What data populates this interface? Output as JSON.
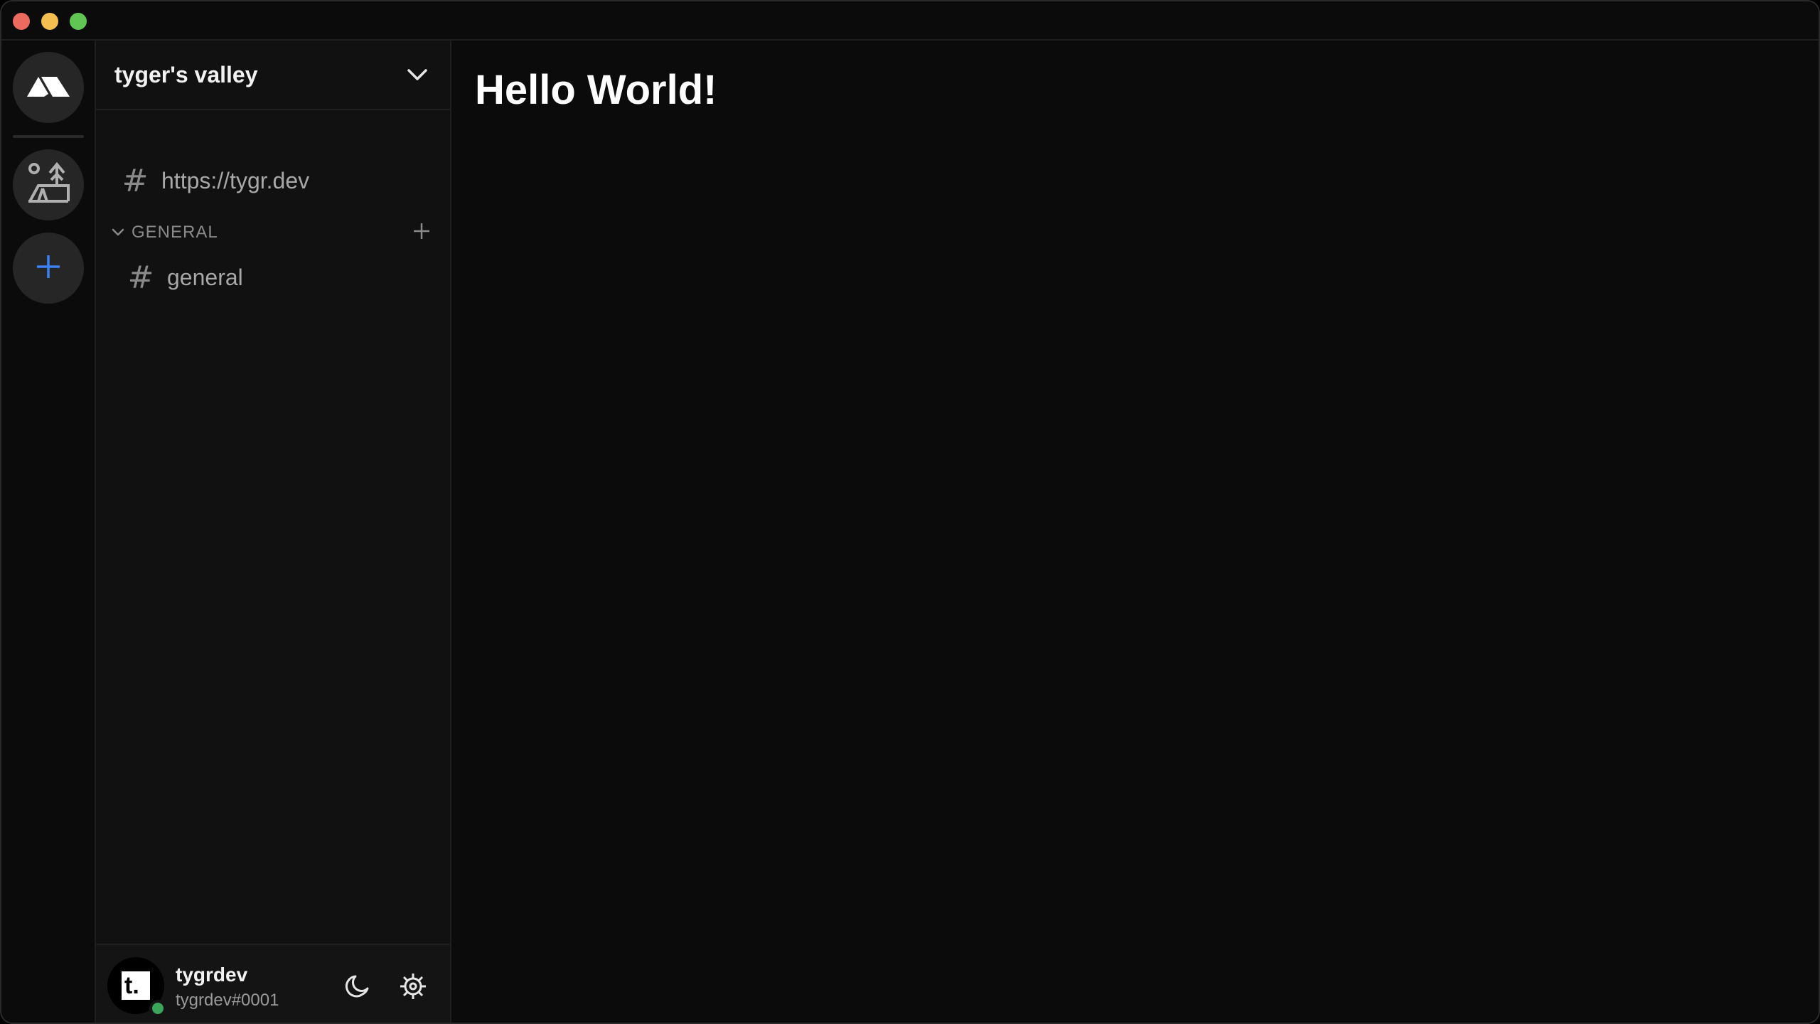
{
  "server": {
    "name": "tyger's valley",
    "pinned_channel": "https://tygr.dev",
    "category": "GENERAL",
    "channels": [
      "general"
    ]
  },
  "user": {
    "name": "tygrdev",
    "tag": "tygrdev#0001",
    "avatar_letter": "t."
  },
  "main": {
    "title": "Hello World!"
  },
  "icons": {
    "home": "mountain-logo-icon",
    "server": "valley-server-icon",
    "add_server": "plus-icon",
    "dropdown": "chevron-down-icon",
    "theme": "moon-icon",
    "settings": "gear-icon"
  },
  "colors": {
    "accent": "#3b82f6",
    "status_online": "#3ba55c",
    "background": "#0b0b0b",
    "panel": "#111111"
  }
}
